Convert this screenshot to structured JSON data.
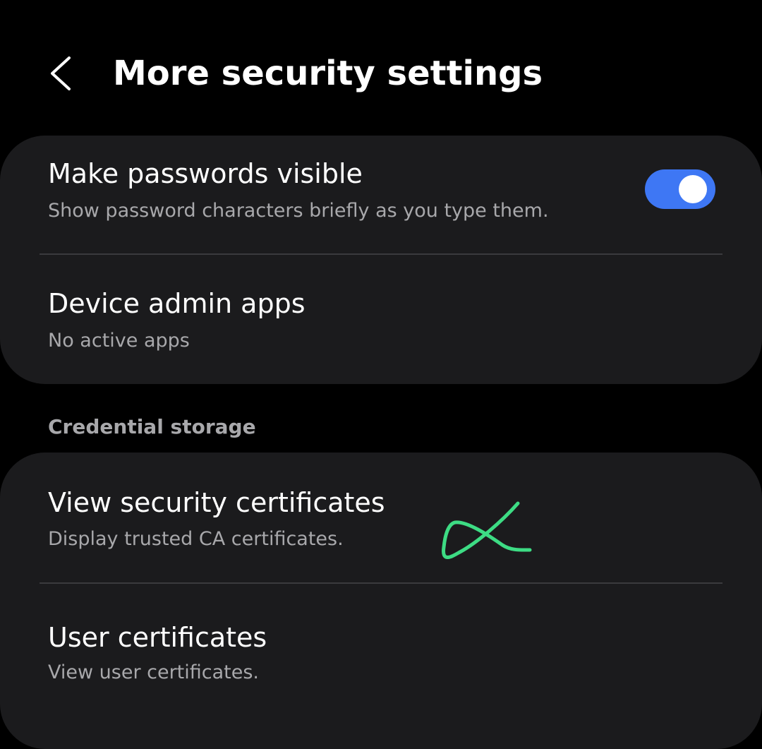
{
  "header": {
    "back_icon": "chevron-left-icon",
    "title": "More security settings"
  },
  "sections": [
    {
      "items": [
        {
          "title": "Make passwords visible",
          "subtitle": "Show password characters briefly as you type them.",
          "toggle": true
        },
        {
          "title": "Device admin apps",
          "subtitle": "No active apps"
        }
      ]
    },
    {
      "header": "Credential storage",
      "items": [
        {
          "title": "View security certificates",
          "subtitle": "Display trusted CA certificates."
        },
        {
          "title": "User certificates",
          "subtitle": "View user certificates."
        }
      ]
    }
  ],
  "colors": {
    "background": "#000000",
    "card": "#1b1b1d",
    "toggle_on": "#3e77f4",
    "secondary_text": "#a8a8ab",
    "annotation": "#3ddc84"
  }
}
